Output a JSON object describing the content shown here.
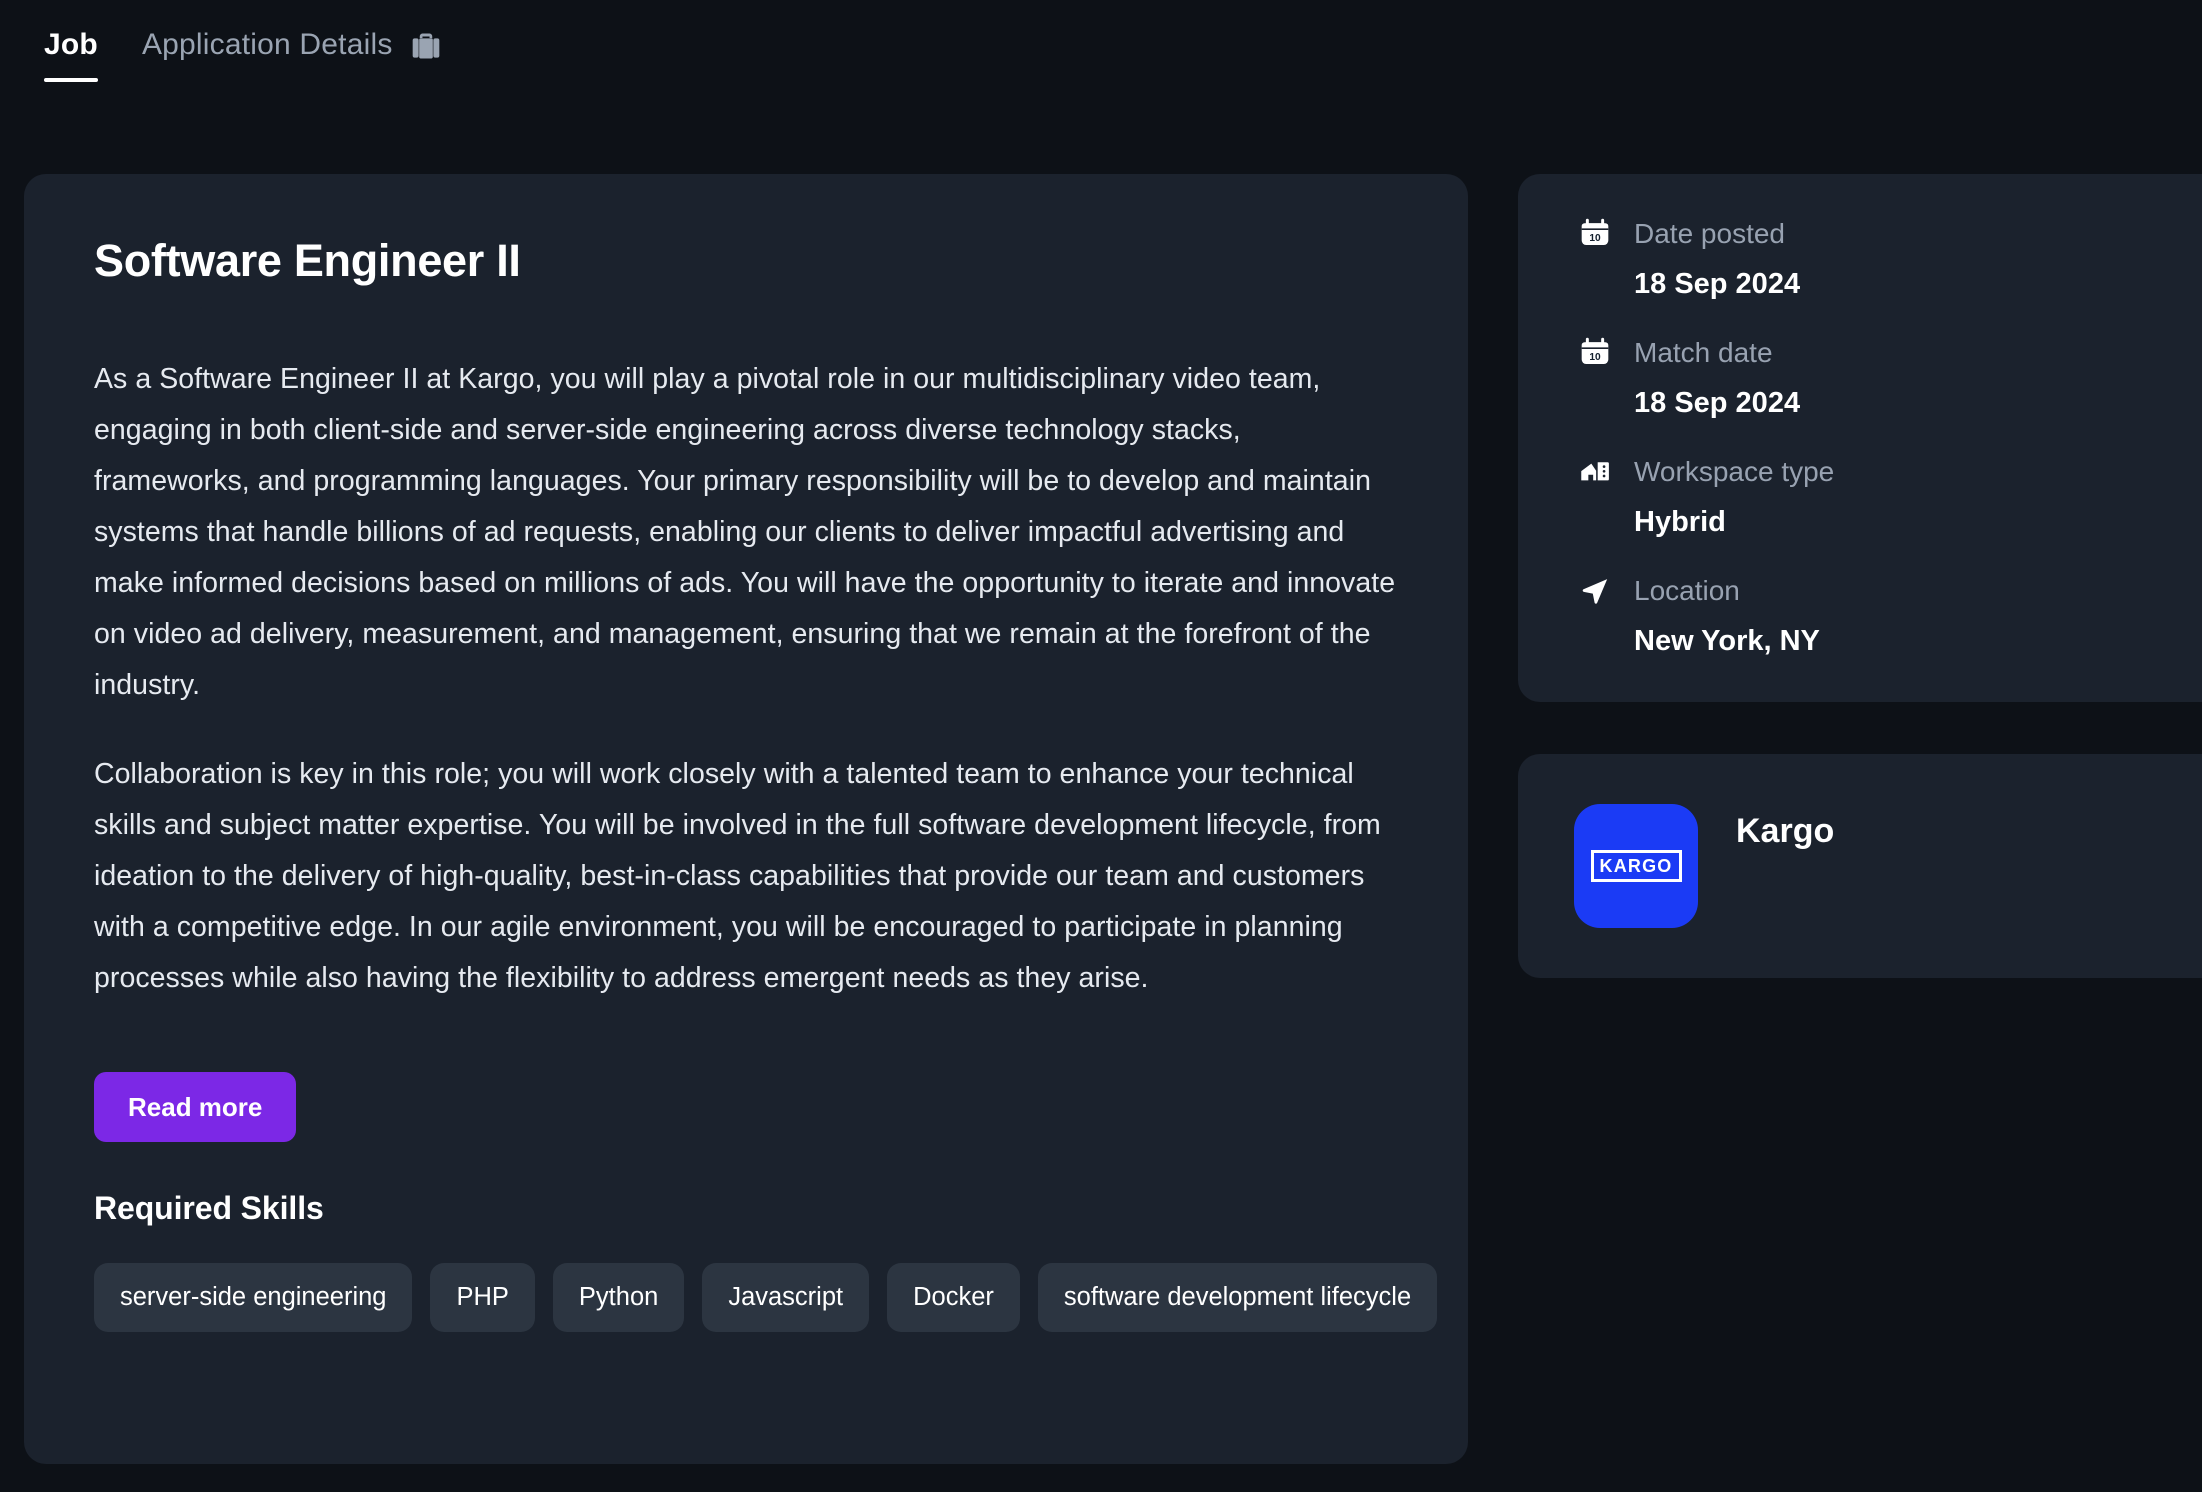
{
  "tabs": [
    {
      "label": "Job",
      "active": true,
      "icon": null
    },
    {
      "label": "Application Details",
      "active": false,
      "icon": "briefcase-icon"
    }
  ],
  "job": {
    "title": "Software Engineer II",
    "paragraphs": [
      "As a Software Engineer II at Kargo, you will play a pivotal role in our multidisciplinary video team, engaging in both client-side and server-side engineering across diverse technology stacks, frameworks, and programming languages. Your primary responsibility will be to develop and maintain systems that handle billions of ad requests, enabling our clients to deliver impactful advertising and make informed decisions based on millions of ads. You will have the opportunity to iterate and innovate on video ad delivery, measurement, and management, ensuring that we remain at the forefront of the industry.",
      "Collaboration is key in this role; you will work closely with a talented team to enhance your technical skills and subject matter expertise. You will be involved in the full software development lifecycle, from ideation to the delivery of high-quality, best-in-class capabilities that provide our team and customers with a competitive edge. In our agile environment, you will be encouraged to participate in planning processes while also having the flexibility to address emergent needs as they arise."
    ],
    "read_more_label": "Read more",
    "skills_heading": "Required Skills",
    "skills": [
      "server-side engineering",
      "PHP",
      "Python",
      "Javascript",
      "Docker",
      "software development lifecycle"
    ]
  },
  "meta": [
    {
      "icon": "calendar-icon",
      "label": "Date posted",
      "value": "18 Sep 2024"
    },
    {
      "icon": "calendar-icon",
      "label": "Match date",
      "value": "18 Sep 2024"
    },
    {
      "icon": "workspace-icon",
      "label": "Workspace type",
      "value": "Hybrid"
    },
    {
      "icon": "location-arrow-icon",
      "label": "Location",
      "value": "New York, NY"
    }
  ],
  "company": {
    "name": "Kargo",
    "logo_text": "KARGO",
    "logo_color": "#1b3bf5"
  },
  "colors": {
    "page_background": "#0d1117",
    "card_background": "#1b222d",
    "tag_background": "#2c3541",
    "accent_button": "#7c28e6",
    "muted_text": "#98a2b1",
    "body_text": "#e6eaf0"
  }
}
